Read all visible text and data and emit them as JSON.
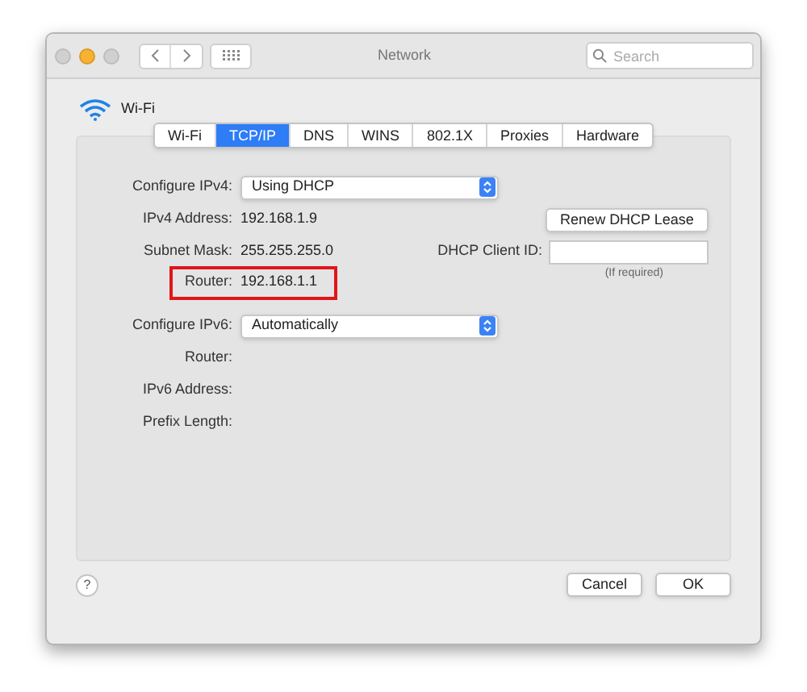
{
  "window": {
    "title": "Network"
  },
  "search": {
    "placeholder": "Search"
  },
  "interface": {
    "name": "Wi-Fi"
  },
  "tabs": [
    {
      "label": "Wi-Fi",
      "selected": false
    },
    {
      "label": "TCP/IP",
      "selected": true
    },
    {
      "label": "DNS",
      "selected": false
    },
    {
      "label": "WINS",
      "selected": false
    },
    {
      "label": "802.1X",
      "selected": false
    },
    {
      "label": "Proxies",
      "selected": false
    },
    {
      "label": "Hardware",
      "selected": false
    }
  ],
  "ipv4": {
    "rows": [
      {
        "kind": "popup",
        "label": "Configure IPv4:",
        "value": "Using DHCP",
        "highlighted": false
      },
      {
        "kind": "value",
        "label": "IPv4 Address:",
        "value": "192.168.1.9",
        "highlighted": false
      },
      {
        "kind": "value",
        "label": "Subnet Mask:",
        "value": "255.255.255.0",
        "highlighted": false
      },
      {
        "kind": "value",
        "label": "Router:",
        "value": "192.168.1.1",
        "highlighted": true
      }
    ],
    "renew_button": "Renew DHCP Lease",
    "client_id": {
      "label": "DHCP Client ID:",
      "hint": "(If required)"
    }
  },
  "ipv6": {
    "rows": [
      {
        "kind": "popup",
        "label": "Configure IPv6:",
        "value": "Automatically",
        "highlighted": false
      },
      {
        "kind": "empty",
        "label": "Router:",
        "highlighted": false
      },
      {
        "kind": "empty",
        "label": "IPv6 Address:",
        "highlighted": false
      },
      {
        "kind": "empty",
        "label": "Prefix Length:",
        "highlighted": false
      }
    ]
  },
  "help": "?",
  "buttons": [
    "Cancel",
    "OK"
  ]
}
